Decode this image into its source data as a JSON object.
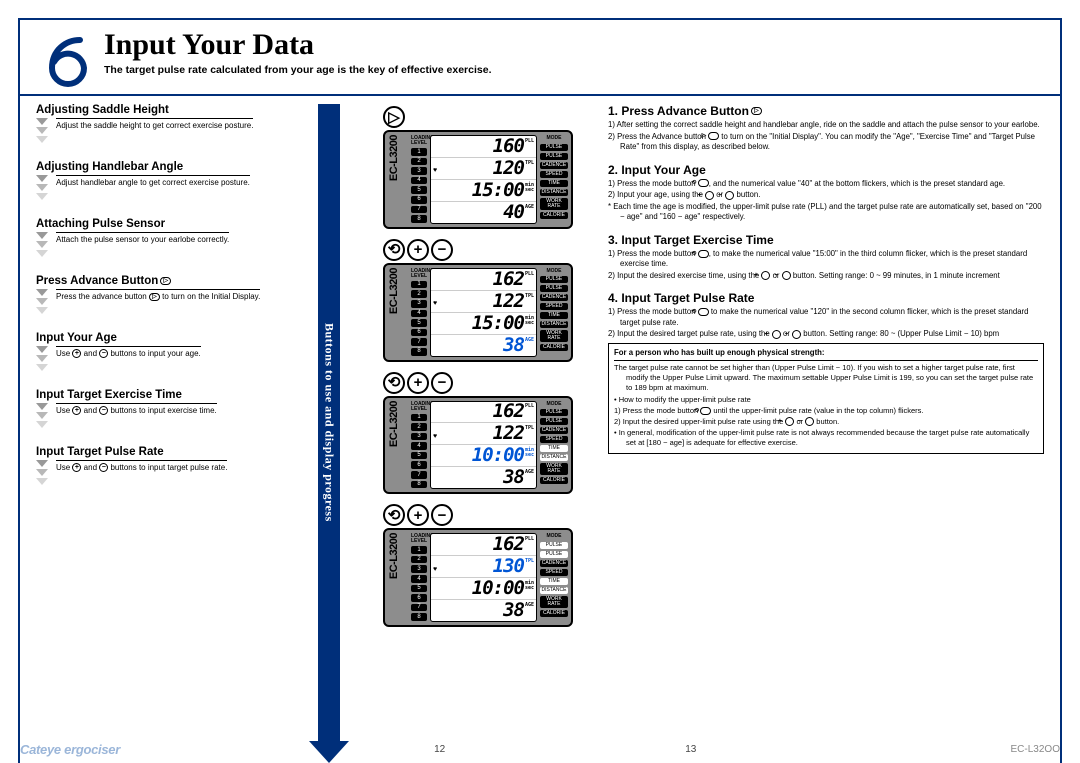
{
  "header": {
    "title": "Input Your Data",
    "subtitle": "The target pulse rate calculated from your age is the key of effective exercise.",
    "step_number": "6"
  },
  "left_column": [
    {
      "h": "Adjusting Saddle Height",
      "p": "Adjust the saddle height to get correct exercise posture."
    },
    {
      "h": "Adjusting Handlebar Angle",
      "p": "Adjust handlebar angle to get correct exercise posture."
    },
    {
      "h": "Attaching Pulse Sensor",
      "p": "Attach the pulse sensor to your earlobe correctly."
    },
    {
      "h": "Press Advance Button",
      "p": "Press the advance button ⟶ to turn on the Initial Display."
    },
    {
      "h": "Input Your Age",
      "p": "Use ⊕ and ⊖ buttons to input your age."
    },
    {
      "h": "Input Target Exercise Time",
      "p": "Use ⊕ and ⊖ buttons to input exercise time."
    },
    {
      "h": "Input Target Pulse Rate",
      "p": "Use ⊕ and ⊖ buttons to input target pulse rate."
    }
  ],
  "arrow_label": "Buttons to use and display progress",
  "lcd_common": {
    "brand": "EC-L3200",
    "left_label": "LOADING LEVEL",
    "left_slots": [
      "1",
      "2",
      "3",
      "4",
      "5",
      "6",
      "7",
      "8"
    ],
    "right_label": "MODE",
    "right_slots": [
      "PULSE",
      "PULSE",
      "CADENCE",
      "SPEED",
      "TIME",
      "DISTANCE",
      "WORK RATE",
      "CALORIE"
    ]
  },
  "lcds": [
    {
      "buttons": [
        "▷"
      ],
      "vals": [
        {
          "v": "160",
          "u": "PLL"
        },
        {
          "v": "120",
          "u": "TPL",
          "heart": true
        },
        {
          "v": "15:00",
          "u": "min sec"
        },
        {
          "v": "40",
          "u": "AGE"
        }
      ],
      "hl": -1,
      "on": []
    },
    {
      "buttons": [
        "⟲",
        "+",
        "−"
      ],
      "vals": [
        {
          "v": "162",
          "u": "PLL"
        },
        {
          "v": "122",
          "u": "TPL",
          "heart": true
        },
        {
          "v": "15:00",
          "u": "min sec"
        },
        {
          "v": "38",
          "u": "AGE"
        }
      ],
      "hl": 3,
      "on": []
    },
    {
      "buttons": [
        "⟲",
        "+",
        "−"
      ],
      "vals": [
        {
          "v": "162",
          "u": "PLL"
        },
        {
          "v": "122",
          "u": "TPL",
          "heart": true
        },
        {
          "v": "10:00",
          "u": "min sec"
        },
        {
          "v": "38",
          "u": "AGE"
        }
      ],
      "hl": 2,
      "on": [
        4,
        5
      ]
    },
    {
      "buttons": [
        "⟲",
        "+",
        "−"
      ],
      "vals": [
        {
          "v": "162",
          "u": "PLL"
        },
        {
          "v": "130",
          "u": "TPL",
          "heart": true
        },
        {
          "v": "10:00",
          "u": "min sec"
        },
        {
          "v": "38",
          "u": "AGE"
        }
      ],
      "hl": 1,
      "on": [
        0,
        1,
        4,
        5
      ]
    }
  ],
  "right_column": [
    {
      "h": "1. Press Advance Button",
      "lines": [
        "1) After setting the correct saddle height and handlebar angle, ride on the saddle and attach the pulse sensor to your earlobe.",
        "2) Press the Advance button ⟶ to turn on the \"Initial Display\". You can modify the \"Age\", \"Exercise Time\" and \"Target Pulse Rate\" from this display, as described below."
      ]
    },
    {
      "h": "2. Input Your Age",
      "lines": [
        "1) Press the mode button ⟲, and the numerical value \"40\" at the bottom flickers, which is the preset standard age.",
        "2) Input your age, using the ⊕ or ⊖ button.",
        "*  Each time the age is modified, the upper-limit pulse rate (PLL) and the target pulse rate are automatically set, based on \"200 − age\" and \"160 − age\" respectively."
      ]
    },
    {
      "h": "3. Input Target Exercise Time",
      "lines": [
        "1) Press the mode button ⟲, to make the numerical value \"15:00\" in the third column flicker, which is the preset standard exercise time.",
        "2) Input the desired exercise time, using the ⊕ or ⊖ button.  Setting range: 0 ~ 99 minutes, in 1 minute increment"
      ]
    },
    {
      "h": "4. Input Target Pulse Rate",
      "lines": [
        "1) Press the mode button ⟲ to make the numerical value \"120\" in the second column flicker, which is the preset standard target pulse rate.",
        "2) Input the desired target pulse rate, using the ⊕ or ⊖ button.  Setting range: 80 ~ (Upper Pulse Limit − 10) bpm"
      ],
      "note": {
        "title": "For a person who has built up enough physical strength:",
        "body": [
          "The target pulse rate cannot be set higher than (Upper Pulse Limit − 10). If you wish to set a higher target pulse rate, first modify the Upper Pulse Limit upward. The maximum settable Upper Pulse Limit is 199, so you can set the target pulse rate to 189 bpm at maximum.",
          "• How to modify the upper-limit pulse rate",
          "1) Press the mode button ⟲ until the upper-limit pulse rate (value in the top column) flickers.",
          "2) Input the desired upper-limit pulse rate using the ⊕ or ⊖ button.",
          "• In general, modification of the upper-limit pulse rate is not always recommended because the target pulse rate automatically set at [180 − age] is adequate for effective exercise."
        ]
      }
    }
  ],
  "footer": {
    "brand": "Cateye ergociser",
    "page_left": "12",
    "page_right": "13",
    "model": "EC-L32OO"
  }
}
